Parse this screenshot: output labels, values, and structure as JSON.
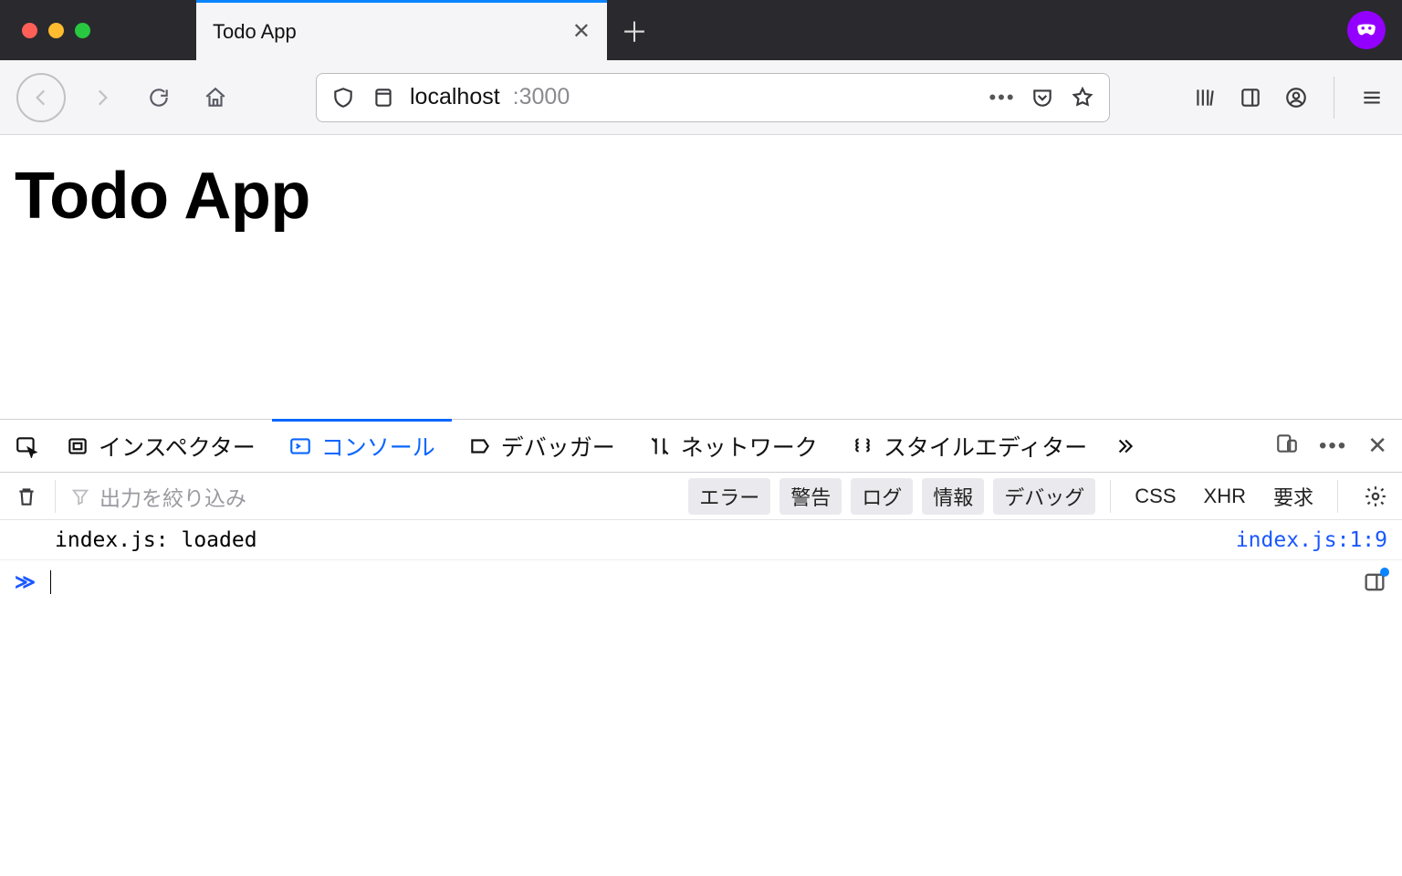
{
  "browser": {
    "tab_title": "Todo App",
    "url_host": "localhost",
    "url_port": ":3000"
  },
  "page": {
    "heading": "Todo App"
  },
  "devtools": {
    "tabs": {
      "inspector": "インスペクター",
      "console": "コンソール",
      "debugger": "デバッガー",
      "network": "ネットワーク",
      "style_editor": "スタイルエディター"
    },
    "filter_placeholder": "出力を絞り込み",
    "chips": {
      "error": "エラー",
      "warn": "警告",
      "log": "ログ",
      "info": "情報",
      "debug": "デバッグ",
      "css": "CSS",
      "xhr": "XHR",
      "requests": "要求"
    },
    "log_message": "index.js: loaded",
    "log_source": "index.js:1:9"
  }
}
